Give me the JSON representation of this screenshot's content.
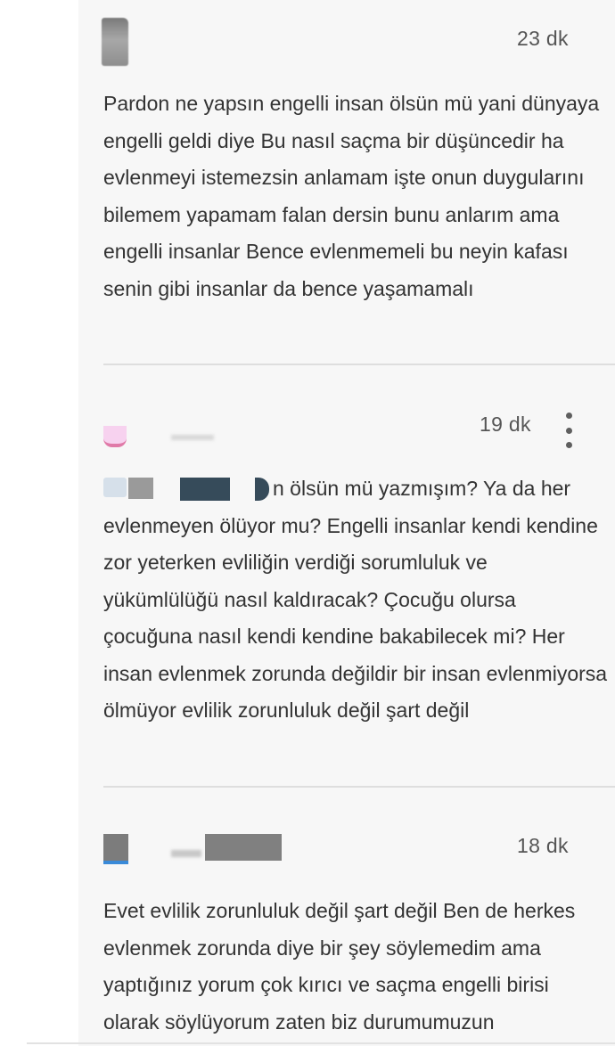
{
  "comments": [
    {
      "time": "23 dk",
      "text": "Pardon ne yapsın engelli insan ölsün mü yani dünyaya engelli geldi diye Bu nasıl saçma bir düşüncedir ha evlenmeyi istemezsin anlamam işte onun duygularını bilemem yapamam falan dersin bunu anlarım ama engelli insanlar Bence evlenmemeli bu neyin kafası senin gibi insanlar da bence yaşamamalı"
    },
    {
      "time": "19 dk",
      "more_icon": "more-vertical-icon",
      "text": "n ölsün mü yazmışım? Ya da her evlenmeyen ölüyor mu? Engelli insanlar kendi kendine zor yeterken evliliğin verdiği sorumluluk ve yükümlülüğü nasıl kaldıracak? Çocuğu olursa çocuğuna nasıl kendi kendine bakabilecek mi? Her insan evlenmek zorunda değildir bir insan evlenmiyorsa ölmüyor evlilik zorunluluk değil şart değil"
    },
    {
      "time": "18 dk",
      "text": "Evet evlilik zorunluluk değil şart değil Ben de herkes evlenmek zorunda diye bir şey söylemedim ama yaptığınız yorum çok kırıcı ve saçma engelli birisi olarak söylüyorum zaten biz durumumuzun"
    }
  ],
  "colors": {
    "feed_background": "#f7f7f7",
    "text": "#333333",
    "timestamp": "#555555",
    "divider": "#dedede",
    "redaction_dark": "#364b5a",
    "redaction_gray": "#808080"
  }
}
